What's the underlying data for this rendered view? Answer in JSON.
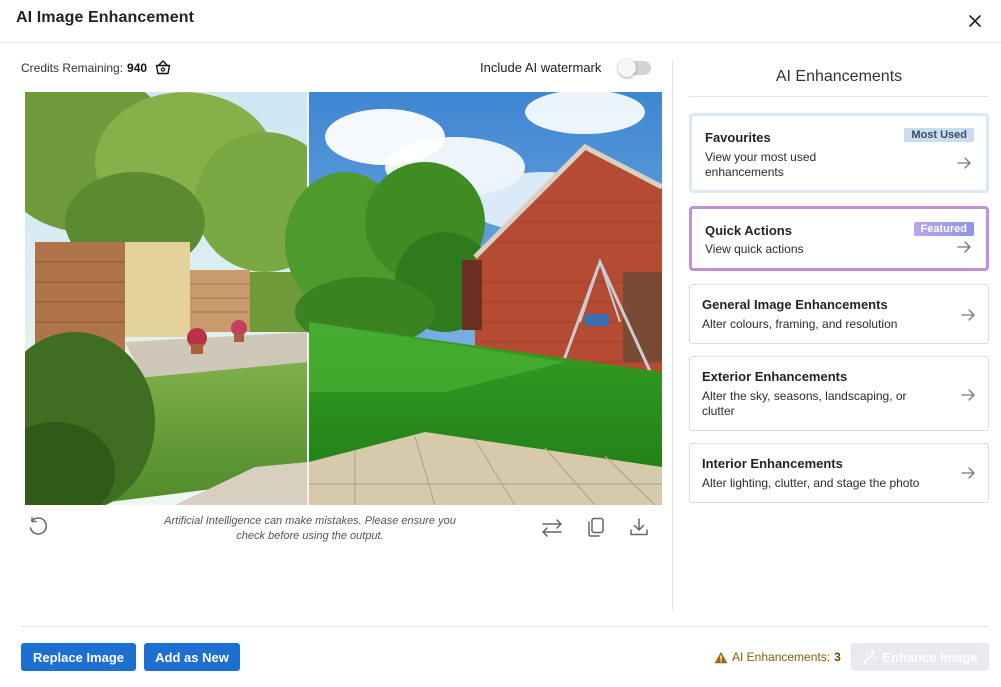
{
  "dialog": {
    "title": "AI Image Enhancement",
    "close_icon": "close-icon"
  },
  "toolbar": {
    "credits_label": "Credits Remaining:",
    "credits_value": "940",
    "credits_icon": "shopping-basket-icon",
    "watermark_label": "Include AI watermark",
    "watermark_enabled": false
  },
  "preview": {
    "disclaimer": "Artificial Intelligence can make mistakes. Please ensure you check before using the output.",
    "icons": [
      "undo-icon",
      "swap-icon",
      "copy-icon",
      "download-icon"
    ]
  },
  "panel": {
    "title": "AI Enhancements",
    "cards": [
      {
        "title": "Favourites",
        "description": "View your most used enhancements",
        "badge": "Most Used",
        "badge_color": "#c9ddf0"
      },
      {
        "title": "Quick Actions",
        "description": "View quick actions",
        "badge": "Featured",
        "badge_color": "#a69be6"
      },
      {
        "title": "General Image Enhancements",
        "description": "Alter colours, framing, and resolution"
      },
      {
        "title": "Exterior Enhancements",
        "description": "Alter the sky, seasons, landscaping, or clutter"
      },
      {
        "title": "Interior Enhancements",
        "description": "Alter lighting, clutter, and stage the photo"
      }
    ]
  },
  "footer": {
    "replace_button": "Replace Image",
    "add_new_button": "Add as New",
    "enhancements_label": "AI Enhancements:",
    "enhancements_count": "3",
    "warning_icon": "warning-icon",
    "enhance_button": "Enhance Image",
    "enhance_icon": "magic-wand-icon"
  },
  "colors": {
    "primary": "#1d6fd1",
    "warning": "#a06a10",
    "featured_border": "#c390d8",
    "favourite_border": "#dbe9f6"
  }
}
